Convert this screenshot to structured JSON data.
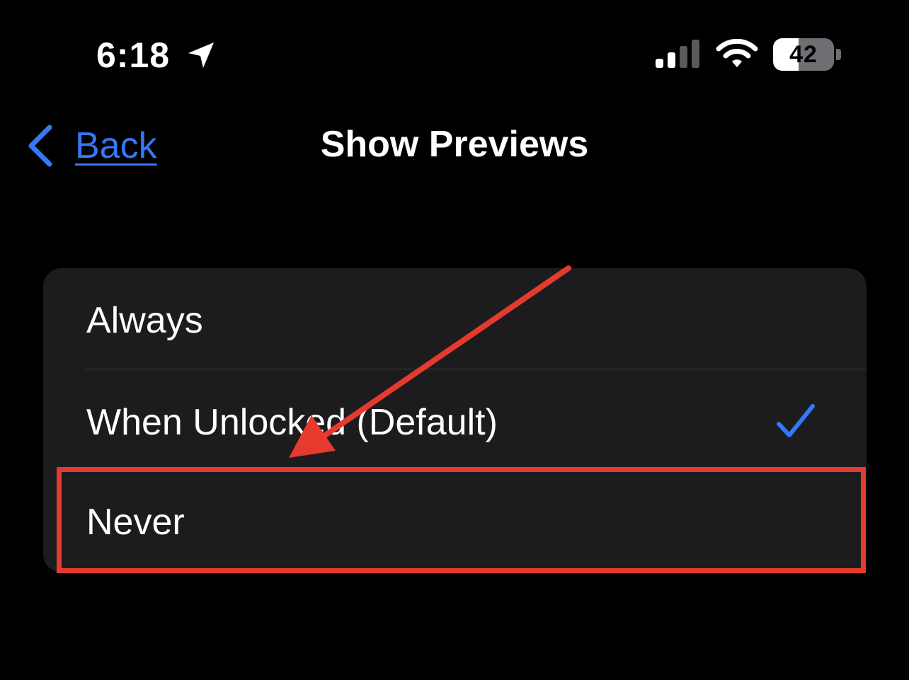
{
  "status_bar": {
    "time": "6:18",
    "battery_percent": "42",
    "battery_level": 0.42,
    "icons": [
      "location-arrow-icon",
      "cellular-signal-icon",
      "wifi-icon",
      "battery-icon"
    ]
  },
  "nav": {
    "back_label": "Back",
    "back_icon": "chevron-left-icon",
    "title": "Show Previews"
  },
  "options": {
    "always": {
      "label": "Always",
      "selected": false
    },
    "when_unlocked": {
      "label": "When Unlocked (Default)",
      "selected": true
    },
    "never": {
      "label": "Never",
      "selected": false
    }
  },
  "colors": {
    "background": "#000000",
    "card": "#1c1c1e",
    "accent_blue": "#3478f6",
    "annotation_red": "#e63a2e",
    "separator": "#3a3a3c"
  },
  "annotations": {
    "highlight_target": "never",
    "arrow_target": "never"
  }
}
